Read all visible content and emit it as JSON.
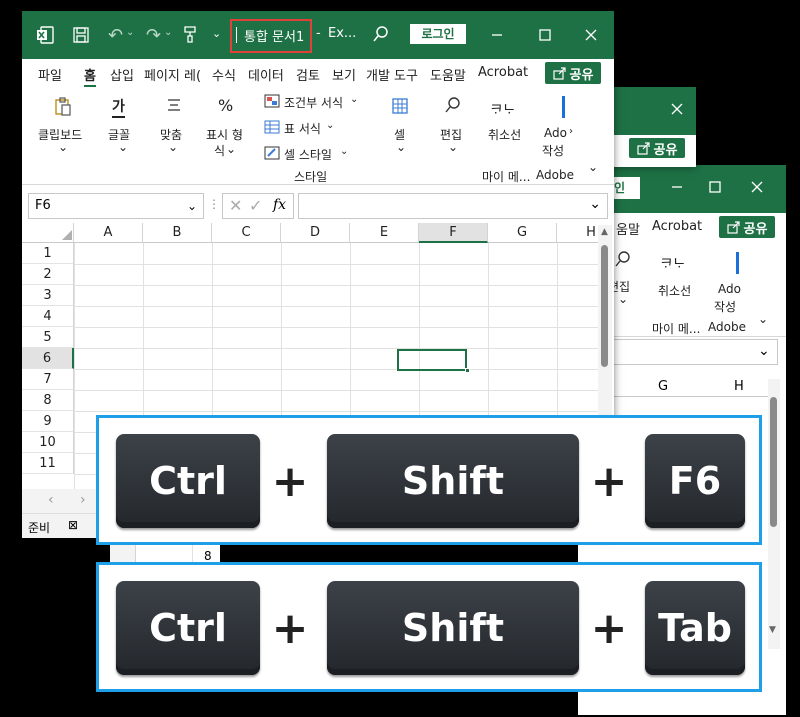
{
  "win3": {
    "login_partial": "인",
    "tabs": [
      "움말",
      "Acrobat"
    ],
    "share": "공유",
    "ribbon": {
      "find_label": "편집",
      "cancel_glyph": "ᄏᆞᄂᆞ",
      "cancel_label": "취소선",
      "adobe_label1": "Ado",
      "adobe_label2": "작성",
      "group1": "마이 메...",
      "group2": "Adobe"
    },
    "col_headers": [
      "G",
      "H"
    ]
  },
  "win2": {
    "share": "공유"
  },
  "win1": {
    "title": "통합 문서1",
    "title_sep": "-",
    "app_name": "Ex...",
    "login": "로그인",
    "tabs": [
      "파일",
      "홈",
      "삽입",
      "페이지 레(",
      "수식",
      "데이터",
      "검토",
      "보기",
      "개발 도구",
      "도움말",
      "Acrobat"
    ],
    "share": "공유",
    "ribbon": {
      "clipboard": "클립보드",
      "font": "글꼴",
      "align": "맞춤",
      "number1": "표시 형",
      "number2": "식",
      "cond_format": "조건부 서식",
      "table_format": "표 서식",
      "cell_style": "셀 스타일",
      "style_group": "스타일",
      "cells": "셀",
      "editing": "편집",
      "strike": "취소선",
      "strike_glyph": "ᄏᆞᄂᆞ",
      "adobe1": "Ado",
      "adobe2": "작성",
      "my_group": "마이 메...",
      "adobe_group": "Adobe"
    },
    "name_box": "F6",
    "fx": "fx",
    "col_headers": [
      "A",
      "B",
      "C",
      "D",
      "E",
      "F",
      "G",
      "H"
    ],
    "row_headers": [
      "1",
      "2",
      "3",
      "4",
      "5",
      "6",
      "7",
      "8",
      "9",
      "10",
      "11"
    ],
    "status_ready": "준비",
    "behind_row_label": "8"
  },
  "shortcuts": [
    {
      "keys": [
        "Ctrl",
        "Shift",
        "F6"
      ],
      "sep": "+"
    },
    {
      "keys": [
        "Ctrl",
        "Shift",
        "Tab"
      ],
      "sep": "+"
    }
  ],
  "colors": {
    "excel_green": "#1e7145",
    "highlight_red": "#e0413a",
    "callout_blue": "#1e9fe8"
  }
}
